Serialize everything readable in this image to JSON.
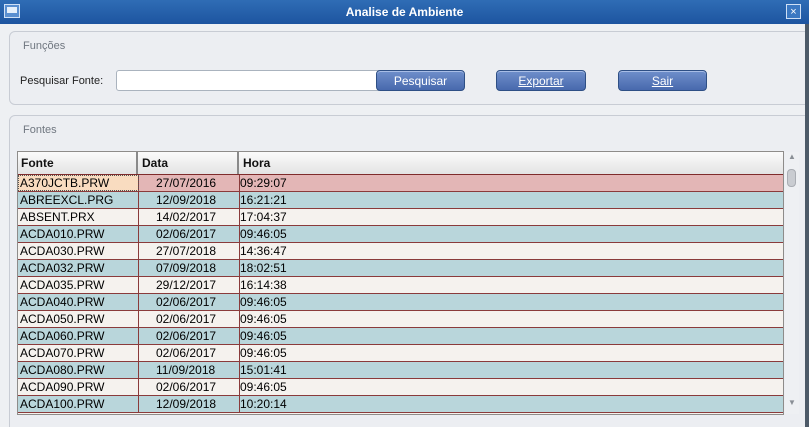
{
  "window": {
    "title": "Analise de Ambiente",
    "close_label": "×"
  },
  "funcoes": {
    "title": "Funções",
    "search_label": "Pesquisar Fonte:",
    "search_value": "",
    "buttons": {
      "pesquisar": "Pesquisar",
      "exportar": "Exportar",
      "sair": "Sair"
    }
  },
  "fontes": {
    "title": "Fontes",
    "columns": [
      "Fonte",
      "Data",
      "Hora"
    ],
    "rows": [
      [
        "A370JCTB.PRW",
        "27/07/2016",
        "09:29:07"
      ],
      [
        "ABREEXCL.PRG",
        "12/09/2018",
        "16:21:21"
      ],
      [
        "ABSENT.PRX",
        "14/02/2017",
        "17:04:37"
      ],
      [
        "ACDA010.PRW",
        "02/06/2017",
        "09:46:05"
      ],
      [
        "ACDA030.PRW",
        "27/07/2018",
        "14:36:47"
      ],
      [
        "ACDA032.PRW",
        "07/09/2018",
        "18:02:51"
      ],
      [
        "ACDA035.PRW",
        "29/12/2017",
        "16:14:38"
      ],
      [
        "ACDA040.PRW",
        "02/06/2017",
        "09:46:05"
      ],
      [
        "ACDA050.PRW",
        "02/06/2017",
        "09:46:05"
      ],
      [
        "ACDA060.PRW",
        "02/06/2017",
        "09:46:05"
      ],
      [
        "ACDA070.PRW",
        "02/06/2017",
        "09:46:05"
      ],
      [
        "ACDA080.PRW",
        "11/09/2018",
        "15:01:41"
      ],
      [
        "ACDA090.PRW",
        "02/06/2017",
        "09:46:05"
      ],
      [
        "ACDA100.PRW",
        "12/09/2018",
        "10:20:14"
      ]
    ]
  },
  "colors": {
    "title_bar": "#1d54a0",
    "row_even": "#b9d6db",
    "row_odd": "#f5f2ee",
    "row_selected": "#e3b6b6",
    "button": "#4869ad"
  }
}
